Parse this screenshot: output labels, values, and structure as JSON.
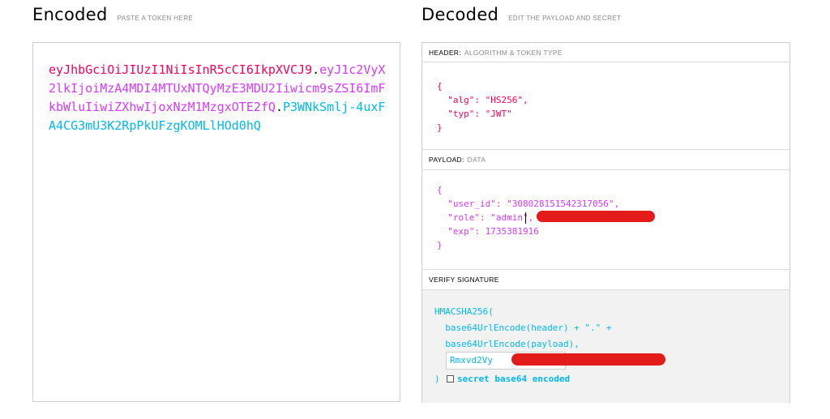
{
  "encoded": {
    "title": "Encoded",
    "hint": "PASTE A TOKEN HERE",
    "token_header": "eyJhbGciOiJIUzI1NiIsInR5cCI6IkpXVCJ9",
    "token_payload": "eyJ1c2VyX2lkIjoiMzA4MDI4MTUxNTQyMzE3MDU2Iiwicm9sZSI6ImFkbWluIiwiZXhwIjoxNzM1MzgxOTE2fQ",
    "token_signature": "P3WNkSmlj-4uxFA4CG3mU3K2RpPkUFzgKOMLlHOd0hQ",
    "dot": "."
  },
  "decoded": {
    "title": "Decoded",
    "hint": "EDIT THE PAYLOAD AND SECRET",
    "header_section": {
      "label": "HEADER:",
      "sublabel": "ALGORITHM & TOKEN TYPE"
    },
    "header_json": "{\n  \"alg\": \"HS256\",\n  \"typ\": \"JWT\"\n}",
    "payload_section": {
      "label": "PAYLOAD:",
      "sublabel": "DATA"
    },
    "payload_json": "{\n  \"user_id\": \"308028151542317056\",\n  \"role\": \"admin\",\n  \"exp\": 1735381916\n}",
    "signature_section": {
      "label": "VERIFY SIGNATURE"
    },
    "signature_code": "HMACSHA256(\n  base64UrlEncode(header) + \".\" +\n  base64UrlEncode(payload),",
    "secret_value": "Rmxvd2Vy",
    "close_paren": ")",
    "secret_base64_label": "secret base64 encoded"
  },
  "colors": {
    "header": "#fb015b",
    "payload": "#d63aff",
    "signature": "#00b9f1",
    "redaction": "#e31b1b"
  }
}
